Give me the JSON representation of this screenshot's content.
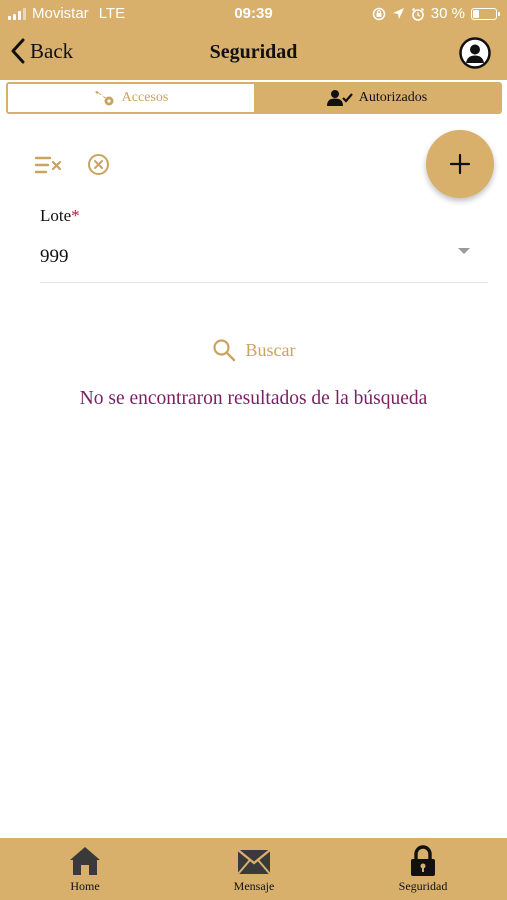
{
  "status_bar": {
    "carrier": "Movistar",
    "network": "LTE",
    "time": "09:39",
    "battery": "30 %",
    "battery_level": 0.3
  },
  "nav": {
    "back_label": "Back",
    "title": "Seguridad",
    "profile_icon": "user-circle-icon"
  },
  "tabs": [
    {
      "label": "Accesos",
      "icon": "key-icon",
      "selected": false
    },
    {
      "label": "Autorizados",
      "icon": "user-check-icon",
      "selected": true
    }
  ],
  "tools": {
    "clear_filters_icon": "clear-filters-icon",
    "clear_icon": "close-circle-icon",
    "add_icon": "plus-icon"
  },
  "filter": {
    "label": "Lote",
    "required_mark": "*",
    "value": "999"
  },
  "search": {
    "label": "Buscar",
    "icon": "search-icon"
  },
  "message": "No se encontraron resultados de la búsqueda",
  "bottom_nav": [
    {
      "label": "Home",
      "icon": "home-icon"
    },
    {
      "label": "Mensaje",
      "icon": "envelope-icon"
    },
    {
      "label": "Seguridad",
      "icon": "lock-icon",
      "selected": true
    }
  ],
  "colors": {
    "accent": "#d8b06c",
    "accent_text": "#c9a35f",
    "message": "#7a1f63",
    "required": "#b2163a"
  }
}
